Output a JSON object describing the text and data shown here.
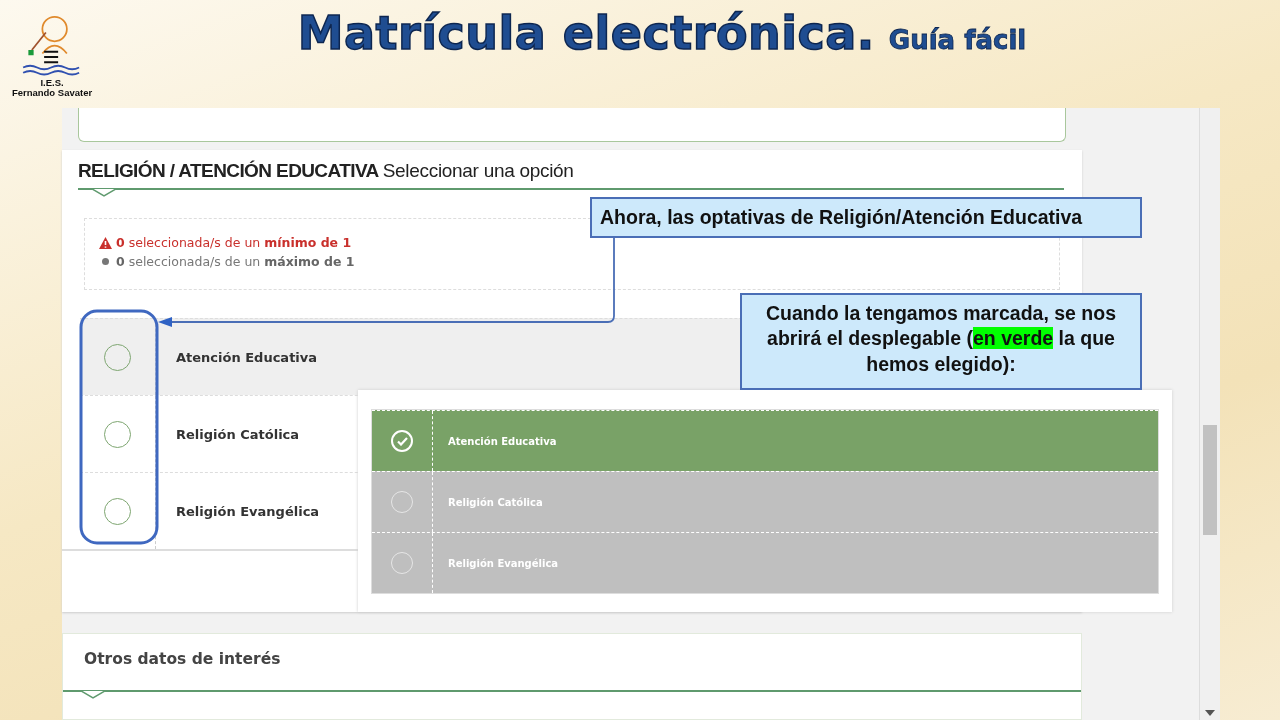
{
  "slide": {
    "title": "Matrícula electrónica.",
    "subtitle": "Guía fácil",
    "logo_lines": [
      "I.E.S.",
      "Fernando Savater"
    ]
  },
  "form": {
    "section_title": "RELIGIÓN / ATENCIÓN EDUCATIVA",
    "section_hint": "Seleccionar una opción",
    "rules": [
      {
        "kind": "warning",
        "text": "**0** seleccionada/s de un **mínimo de 1**"
      },
      {
        "kind": "info",
        "text": "**0** seleccionada/s de un **máximo de 1**"
      }
    ],
    "options": [
      {
        "label": "Atención Educativa",
        "highlighted": true
      },
      {
        "label": "Religión Católica",
        "highlighted": false
      },
      {
        "label": "Religión Evangélica",
        "highlighted": false
      }
    ],
    "dropdown": [
      {
        "label": "Atención Educativa",
        "selected": true
      },
      {
        "label": "Religión Católica",
        "selected": false
      },
      {
        "label": "Religión Evangélica",
        "selected": false
      }
    ],
    "next_section": "Otros datos de interés"
  },
  "callouts": [
    {
      "text": "Ahora, las optativas de Religión/Atención Educativa"
    },
    {
      "text": "Cuando la tengamos marcada, se nos abrirá el desplegable (*en verde* la que hemos elegido):"
    }
  ]
}
